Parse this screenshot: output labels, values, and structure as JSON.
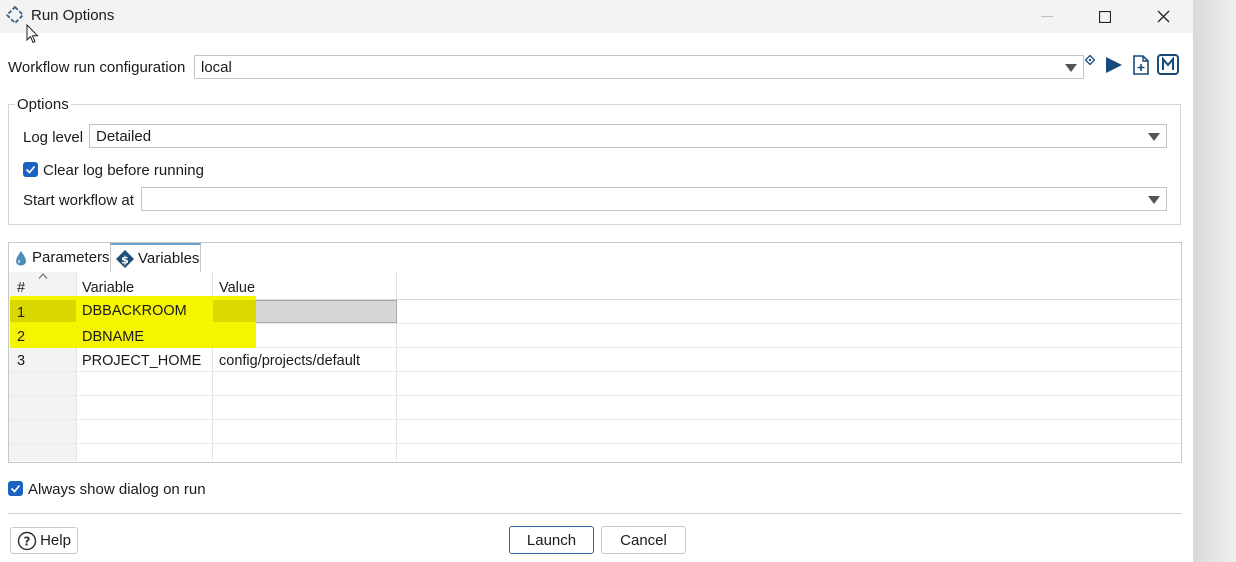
{
  "window": {
    "title": "Run Options"
  },
  "run_config": {
    "label": "Workflow run configuration",
    "value": "local",
    "icons": [
      "diamond-small-icon",
      "play-icon",
      "new-file-icon",
      "m-icon"
    ]
  },
  "options": {
    "group_title": "Options",
    "log_level_label": "Log level",
    "log_level_value": "Detailed",
    "clear_log_label": "Clear log before running",
    "clear_log_checked": true,
    "start_label": "Start workflow at",
    "start_value": ""
  },
  "tabs": [
    {
      "label": "Parameters",
      "icon": "parameters-icon",
      "active": false
    },
    {
      "label": "Variables",
      "icon": "dollar-icon",
      "active": true
    }
  ],
  "table": {
    "sort_indicator": "^",
    "columns": [
      "#",
      "Variable",
      "Value"
    ],
    "rows": [
      {
        "num": "1",
        "variable": "DBBACKROOM",
        "value": ""
      },
      {
        "num": "2",
        "variable": "DBNAME",
        "value": ""
      },
      {
        "num": "3",
        "variable": "PROJECT_HOME",
        "value": "config/projects/default"
      }
    ]
  },
  "always_show": {
    "label": "Always show dialog on run",
    "checked": true
  },
  "buttons": {
    "help": "Help",
    "launch": "Launch",
    "cancel": "Cancel"
  },
  "colors": {
    "accent": "#1a63c2",
    "highlight": "#f5f500",
    "highlight_dark": "#d9d900",
    "play": "#164a7a"
  }
}
